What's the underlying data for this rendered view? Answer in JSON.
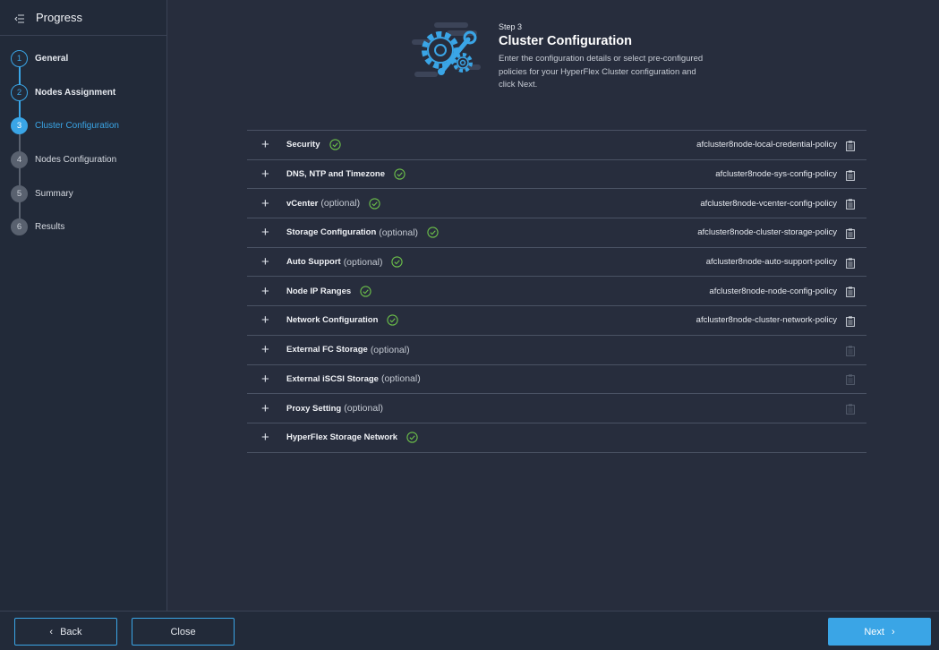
{
  "sidebar": {
    "title": "Progress",
    "steps": [
      {
        "num": "1",
        "label": "General",
        "state": "done"
      },
      {
        "num": "2",
        "label": "Nodes Assignment",
        "state": "done"
      },
      {
        "num": "3",
        "label": "Cluster Configuration",
        "state": "active"
      },
      {
        "num": "4",
        "label": "Nodes Configuration",
        "state": "pending"
      },
      {
        "num": "5",
        "label": "Summary",
        "state": "pending"
      },
      {
        "num": "6",
        "label": "Results",
        "state": "pending"
      }
    ]
  },
  "header": {
    "step": "Step 3",
    "title": "Cluster Configuration",
    "description": "Enter the configuration details or select pre-configured policies for your HyperFlex Cluster configuration and click Next."
  },
  "sections": [
    {
      "title": "Security",
      "optional": "",
      "checked": true,
      "policy": "afcluster8node-local-credential-policy",
      "has_policy": true
    },
    {
      "title": "DNS, NTP and Timezone",
      "optional": "",
      "checked": true,
      "policy": "afcluster8node-sys-config-policy",
      "has_policy": true
    },
    {
      "title": "vCenter",
      "optional": "(optional)",
      "checked": true,
      "policy": "afcluster8node-vcenter-config-policy",
      "has_policy": true
    },
    {
      "title": "Storage Configuration",
      "optional": "(optional)",
      "checked": true,
      "policy": "afcluster8node-cluster-storage-policy",
      "has_policy": true
    },
    {
      "title": "Auto Support",
      "optional": "(optional)",
      "checked": true,
      "policy": "afcluster8node-auto-support-policy",
      "has_policy": true
    },
    {
      "title": "Node IP Ranges",
      "optional": "",
      "checked": true,
      "policy": "afcluster8node-node-config-policy",
      "has_policy": true
    },
    {
      "title": "Network Configuration",
      "optional": "",
      "checked": true,
      "policy": "afcluster8node-cluster-network-policy",
      "has_policy": true
    },
    {
      "title": "External FC Storage",
      "optional": "(optional)",
      "checked": false,
      "policy": "",
      "has_policy": false
    },
    {
      "title": "External iSCSI Storage",
      "optional": "(optional)",
      "checked": false,
      "policy": "",
      "has_policy": false
    },
    {
      "title": "Proxy Setting",
      "optional": "(optional)",
      "checked": false,
      "policy": "",
      "has_policy": false
    },
    {
      "title": "HyperFlex Storage Network",
      "optional": "",
      "checked": true,
      "policy": "",
      "has_policy": null
    }
  ],
  "footer": {
    "back_label": "Back",
    "close_label": "Close",
    "next_label": "Next"
  },
  "colors": {
    "accent": "#3aa5e6",
    "check": "#6cc04a",
    "background": "#272d3d",
    "sidebar": "#222a39"
  },
  "icons": {
    "menu": "collapse-menu-icon",
    "plus": "plus-icon",
    "check": "check-circle-icon",
    "policy": "clipboard-icon",
    "hero": "gear-wrench-icon"
  }
}
